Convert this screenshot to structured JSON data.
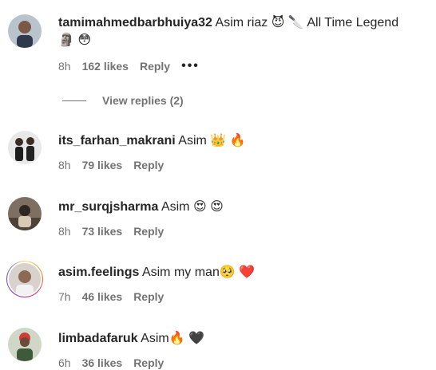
{
  "comments": [
    {
      "username": "tamimahmedbarbhuiya32",
      "text": "Asim riaz",
      "emojis": "😈 🔪 ",
      "text2": "All Time Legend",
      "emojis2": "🗿 😳",
      "time": "8h",
      "likes": "162 likes",
      "reply": "Reply",
      "more": "•••",
      "view_replies": "View replies (2)"
    },
    {
      "username": "its_farhan_makrani",
      "text": "Asim",
      "emojis": "👑 🔥",
      "time": "8h",
      "likes": "79 likes",
      "reply": "Reply"
    },
    {
      "username": "mr_surqjsharma",
      "text": "Asim",
      "emojis": "😍 😍",
      "time": "8h",
      "likes": "73 likes",
      "reply": "Reply"
    },
    {
      "username": "asim.feelings",
      "text": "Asim my man",
      "emojis": "🥺 ❤️",
      "time": "7h",
      "likes": "46 likes",
      "reply": "Reply"
    },
    {
      "username": "limbadafaruk",
      "text": "Asim",
      "emojis": "🔥 🖤",
      "time": "6h",
      "likes": "36 likes",
      "reply": "Reply"
    }
  ]
}
